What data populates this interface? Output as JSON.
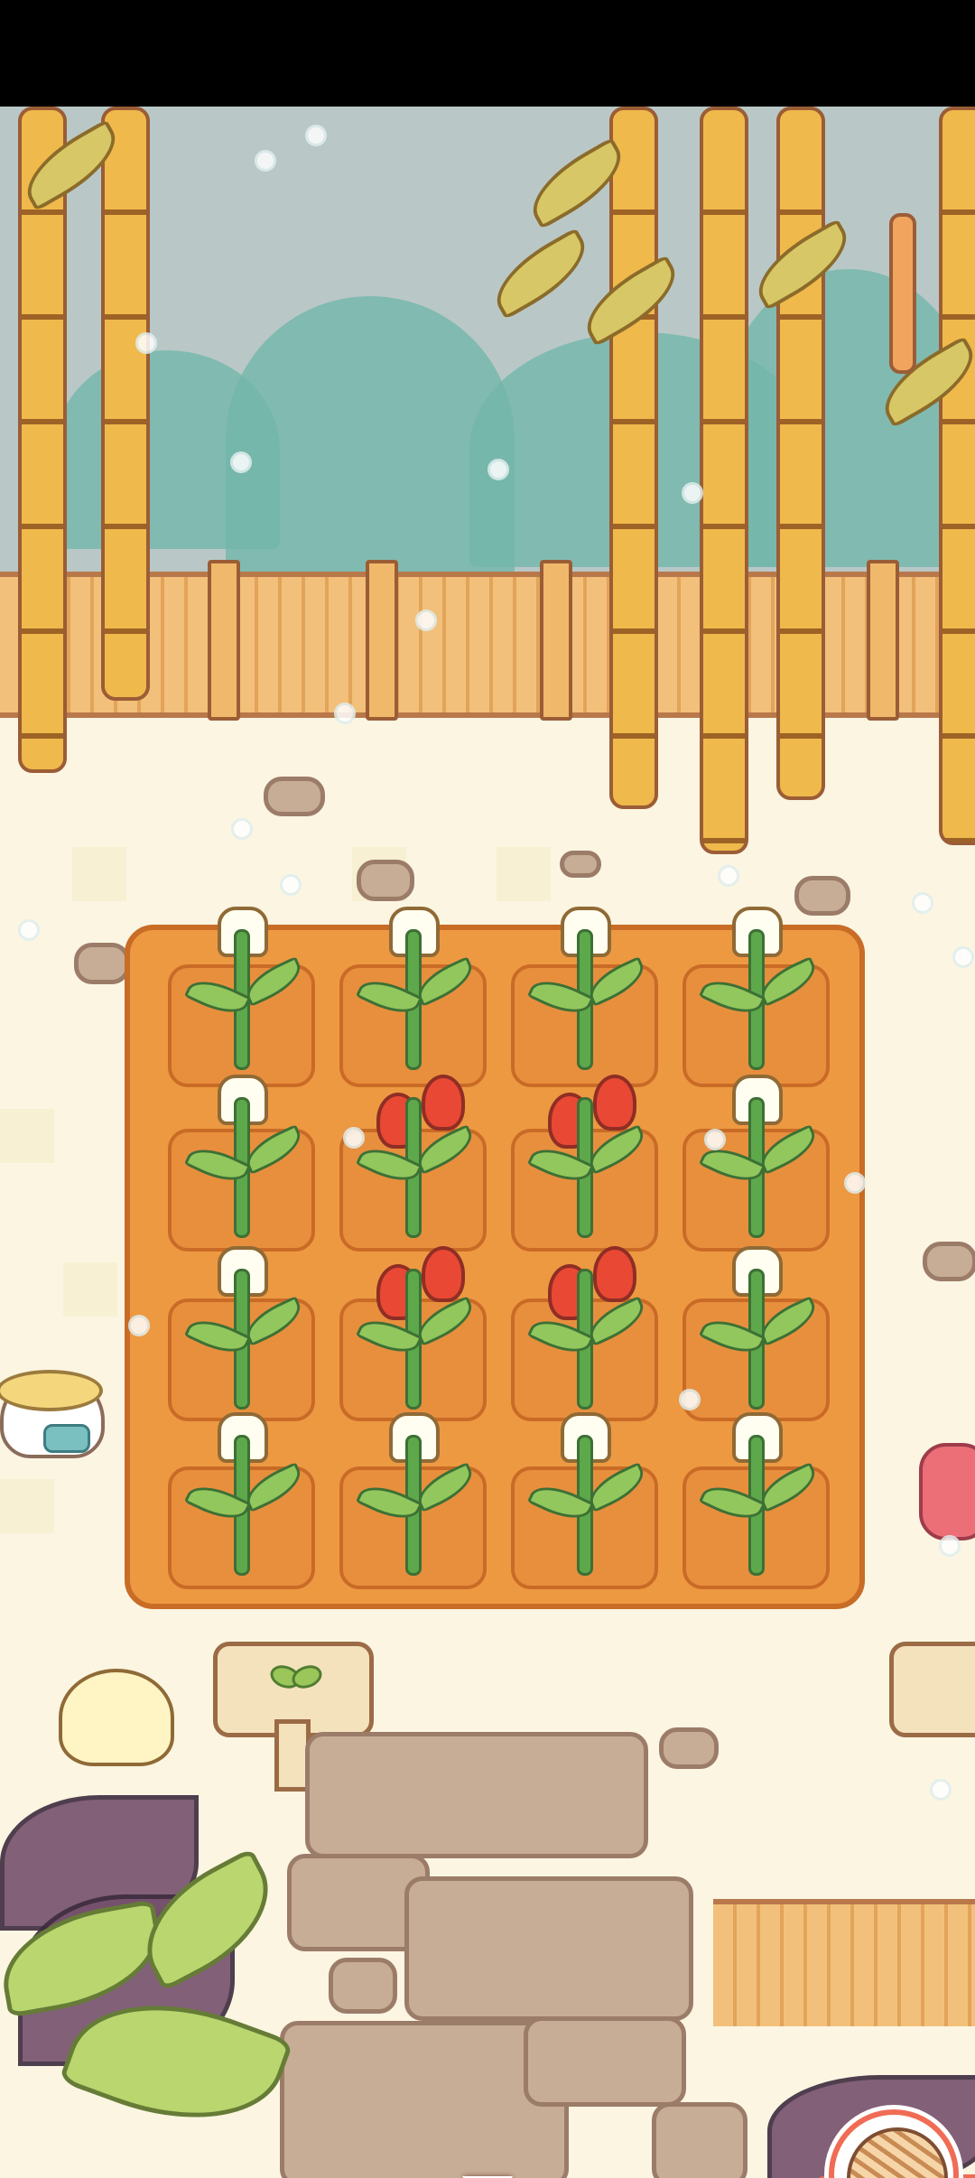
{
  "status_bar": {},
  "game": {
    "scene": "garden",
    "plot": {
      "rows": 4,
      "columns": 4,
      "plants": [
        [
          "white-flower",
          "white-flower",
          "white-flower",
          "white-flower"
        ],
        [
          "white-flower",
          "red-flower",
          "red-flower",
          "white-flower"
        ],
        [
          "white-flower",
          "red-flower",
          "red-flower",
          "white-flower"
        ],
        [
          "white-flower",
          "white-flower",
          "white-flower",
          "white-flower"
        ]
      ]
    },
    "controls": {
      "collapse_icon": "down-triangle-icon",
      "yarn_icon": "yarn-ball-icon"
    },
    "colors": {
      "soil": "#ed9942",
      "ground": "#fbf5e2",
      "sky": "#b9c8c7",
      "accent": "#f06c55",
      "leaf": "#5da84b",
      "red_flower": "#e94835"
    }
  }
}
